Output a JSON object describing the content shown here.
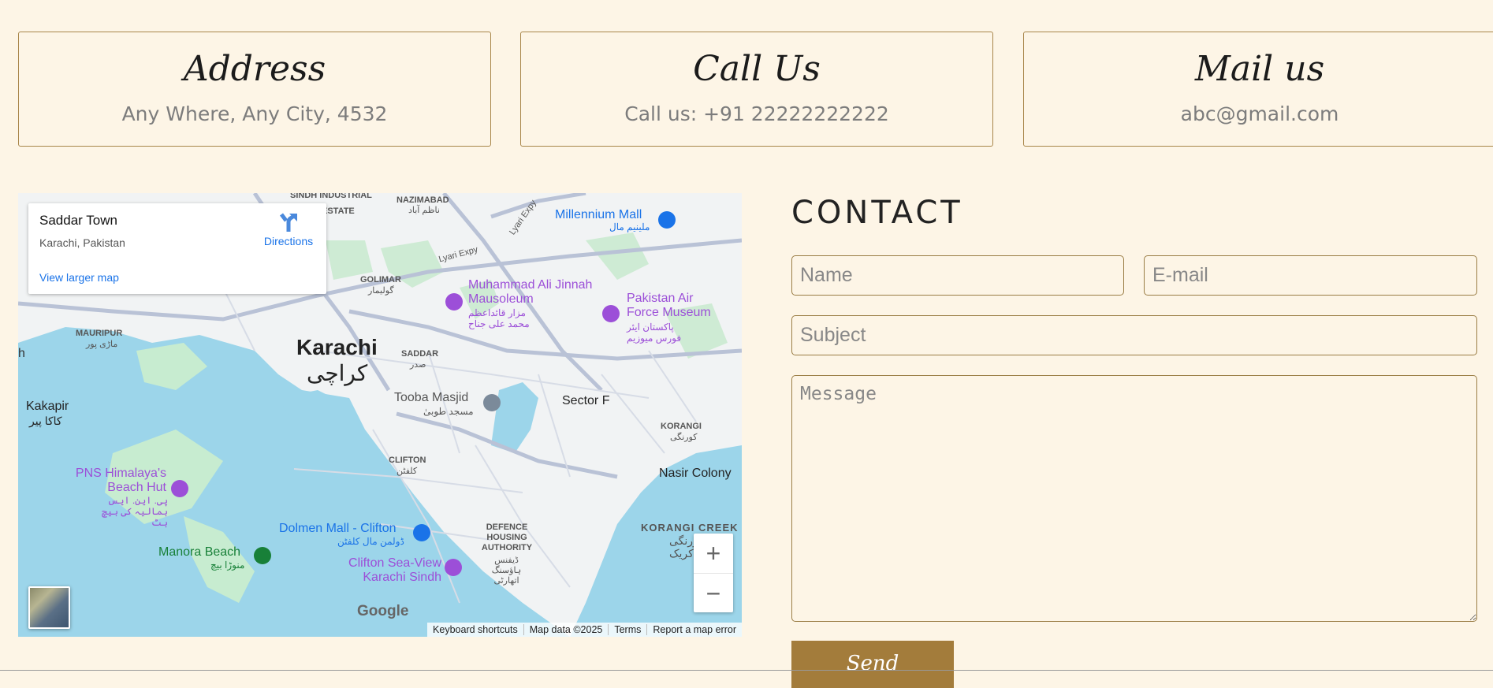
{
  "cards": [
    {
      "title": "Address",
      "text": "Any Where, Any City, 4532"
    },
    {
      "title": "Call Us",
      "text": "Call us: +91 22222222222"
    },
    {
      "title": "Mail us",
      "text": "abc@gmail.com"
    }
  ],
  "map": {
    "place_name": "Saddar Town",
    "place_sub": "Karachi, Pakistan",
    "directions_label": "Directions",
    "larger_map_label": "View larger map",
    "labels": {
      "karachi": "Karachi",
      "karachi_ur": "کراچی",
      "sindh_industrial": "SINDH INDUSTRIAL",
      "estate": "ESTATE",
      "nazimabad": "NAZIMABAD",
      "nazimabad_ur": "ناظم آباد",
      "millennium_mall": "Millennium Mall",
      "millennium_mall_ur": "ملینیم مال",
      "lyari_expy": "Lyari Expy",
      "lyari_expy2": "Lyari Expy",
      "golimar": "GOLIMAR",
      "golimar_ur": "گولیمار",
      "mausoleum": "Muhammad Ali Jinnah Mausoleum",
      "mausoleum_ur": "مزار قائداعظم محمد علی جناح",
      "paf_museum": "Pakistan Air Force Museum",
      "paf_museum_ur": "پاکستان ایئر فورس میوزیم",
      "mauripur": "MAURIPUR",
      "mauripur_ur": "ماڑی پور",
      "saddar": "SADDAR",
      "saddar_ur": "صدر",
      "tooba_masjid": "Tooba Masjid",
      "tooba_masjid_ur": "مسجد طوبیٰ",
      "sector_f": "Sector F",
      "kakapir": "Kakapir",
      "kakapir_ur": "کاکا پیر",
      "korangi": "KORANGI",
      "korangi_ur": "کورنگی",
      "clifton": "CLIFTON",
      "clifton_ur": "کلفٹن",
      "nasir_colony": "Nasir Colony",
      "pns_himalaya": "PNS Himalaya's Beach Hut",
      "pns_himalaya_ur": "پی. این. ایس ہمالیہ کی بیچ ہٹ",
      "dolmen_mall": "Dolmen Mall - Clifton",
      "dolmen_mall_ur": "ڈولمن مال کلفٹن",
      "dha": "DEFENCE HOUSING AUTHORITY",
      "dha_ur": "ڈیفنس ہاؤسنگ اتھارٹی",
      "korangi_creek": "KORANGI CREEK",
      "korangi_creek_ur": "کورنگی کریک",
      "manora_beach": "Manora Beach",
      "manora_beach_ur": "منوڑا بیچ",
      "clifton_seaview": "Clifton Sea-View Karachi Sindh",
      "h_edge": "h"
    },
    "zoom_in": "+",
    "zoom_out": "−",
    "google_logo": "Google",
    "attribution": {
      "keyboard": "Keyboard shortcuts",
      "map_data": "Map data ©2025",
      "terms": "Terms",
      "report": "Report a map error"
    }
  },
  "contact": {
    "title": "CONTACT",
    "name_placeholder": "Name",
    "email_placeholder": "E-mail",
    "subject_placeholder": "Subject",
    "message_placeholder": "Message",
    "send_label": "Send"
  }
}
